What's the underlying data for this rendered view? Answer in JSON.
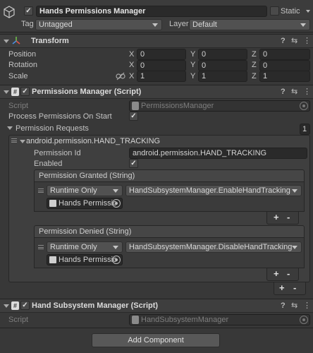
{
  "gameobject": {
    "name": "Hands Permissions Manager",
    "static_label": "Static",
    "tag_label": "Tag",
    "tag_value": "Untagged",
    "layer_label": "Layer",
    "layer_value": "Default"
  },
  "transform": {
    "title": "Transform",
    "rows": [
      {
        "label": "Position",
        "x": "0",
        "y": "0",
        "z": "0"
      },
      {
        "label": "Rotation",
        "x": "0",
        "y": "0",
        "z": "0"
      },
      {
        "label": "Scale",
        "x": "1",
        "y": "1",
        "z": "1"
      }
    ],
    "axis_x": "X",
    "axis_y": "Y",
    "axis_z": "Z"
  },
  "permissions_manager": {
    "title": "Permissions Manager (Script)",
    "script_label": "Script",
    "script_value": "PermissionsManager",
    "process_label": "Process Permissions On Start",
    "requests_label": "Permission Requests",
    "requests_count": "1",
    "element_title": "android.permission.HAND_TRACKING",
    "permission_id_label": "Permission Id",
    "permission_id_value": "android.permission.HAND_TRACKING",
    "enabled_label": "Enabled",
    "granted": {
      "title": "Permission Granted (String)",
      "runtime": "Runtime Only",
      "function": "HandSubsystemManager.EnableHandTracking",
      "object": "Hands Permissio"
    },
    "denied": {
      "title": "Permission Denied (String)",
      "runtime": "Runtime Only",
      "function": "HandSubsystemManager.DisableHandTracking",
      "object": "Hands Permissio"
    },
    "plus": "+",
    "minus": "-"
  },
  "hand_subsystem": {
    "title": "Hand Subsystem Manager (Script)",
    "script_label": "Script",
    "script_value": "HandSubsystemManager"
  },
  "add_component": "Add Component",
  "icons": {
    "help": "?",
    "presets": "⇆",
    "menu": "⋮",
    "check": "✓",
    "script": "#"
  }
}
